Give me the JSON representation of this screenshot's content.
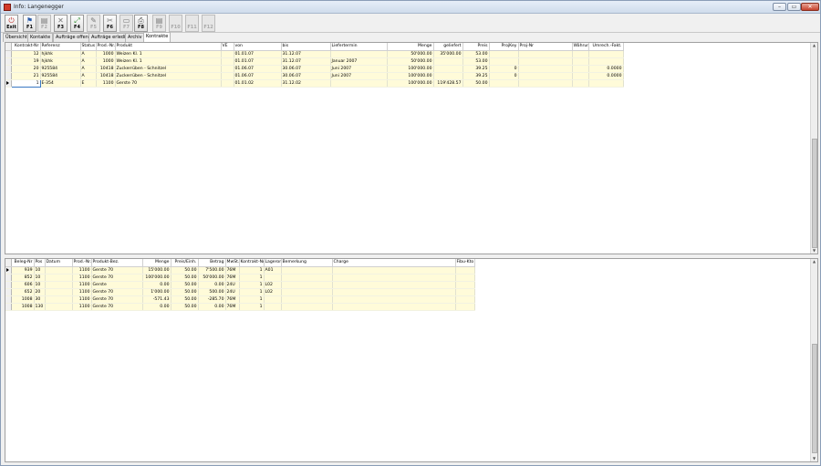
{
  "window": {
    "title": "Info: Langenegger",
    "controls": [
      "–",
      "▭",
      "✕"
    ]
  },
  "toolbar": [
    {
      "label": "Exit",
      "icon": "⏻",
      "color": "#c0302a",
      "enabled": true
    },
    {
      "label": "F1",
      "icon": "⚑",
      "color": "#2a5aa8",
      "enabled": true
    },
    {
      "label": "F2",
      "icon": "▤",
      "color": "#777",
      "enabled": false
    },
    {
      "label": "F3",
      "icon": "✕",
      "color": "#777",
      "enabled": true
    },
    {
      "label": "F4",
      "icon": "⤢",
      "color": "#2f8f2f",
      "enabled": true
    },
    {
      "label": "F5",
      "icon": "✎",
      "color": "#777",
      "enabled": false
    },
    {
      "label": "F6",
      "icon": "✂",
      "color": "#777",
      "enabled": true
    },
    {
      "label": "F7",
      "icon": "▭",
      "color": "#777",
      "enabled": false
    },
    {
      "label": "F8",
      "icon": "⎙",
      "color": "#555",
      "enabled": true
    },
    {
      "label": "F9",
      "icon": "▤",
      "color": "#777",
      "enabled": false
    },
    {
      "label": "F10",
      "icon": "",
      "color": "#777",
      "enabled": false
    },
    {
      "label": "F11",
      "icon": "",
      "color": "#777",
      "enabled": false
    },
    {
      "label": "F12",
      "icon": "",
      "color": "#777",
      "enabled": false
    }
  ],
  "tabs": [
    "Übersicht",
    "Kontakte",
    "Aufträge offen",
    "Aufträge erledigt",
    "Archiv",
    "Kontrakte"
  ],
  "active_tab": 5,
  "contracts": {
    "columns": [
      "Kontrakt-Nr",
      "Referenz",
      "Status",
      "Prod.-Nr.",
      "Produkt",
      "VE",
      "von",
      "bis",
      "Liefertermin",
      "Menge",
      "geliefert",
      "Preis",
      "ProjKey",
      "Proj-Nr",
      "Währung",
      "Umrech.-Fakt."
    ],
    "rows": [
      [
        "12",
        "hjkhk",
        "A",
        "1000",
        "Weizen Kl. 1",
        "",
        "01.01.07",
        "31.12.07",
        "",
        "50'000.00",
        "35'000.00",
        "53.00",
        "",
        "",
        "",
        ""
      ],
      [
        "19",
        "hjkhk",
        "A",
        "1000",
        "Weizen Kl. 1",
        "",
        "01.01.07",
        "31.12.07",
        "Januar 2007",
        "50'000.00",
        "",
        "53.00",
        "",
        "",
        "",
        ""
      ],
      [
        "20",
        "925584",
        "A",
        "10418",
        "Zuckerrüben - Schnitzel",
        "",
        "01.06.07",
        "30.06.07",
        "Juni 2007",
        "100'000.00",
        "",
        "39.25",
        "0",
        "",
        "",
        "0.0000"
      ],
      [
        "21",
        "925584",
        "A",
        "10418",
        "Zuckerrüben - Schnitzel",
        "",
        "01.06.07",
        "30.06.07",
        "Juni 2007",
        "100'000.00",
        "",
        "39.25",
        "0",
        "",
        "",
        "0.0000"
      ],
      [
        "1",
        "E-354",
        "E",
        "1100",
        "Gerste 70",
        "",
        "01.01.02",
        "31.12.02",
        "",
        "100'000.00",
        "119'428.57",
        "50.00",
        "",
        "",
        "",
        ""
      ]
    ],
    "selected_row": 4
  },
  "documents": {
    "columns": [
      "Beleg-Nr",
      "Pos",
      "Datum",
      "Prod.-Nr.",
      "Produkt-Bez.",
      "Menge",
      "Preis/Einh.",
      "Betrag",
      "MwSt.",
      "Kontrakt-Nr",
      "Lagerort",
      "Bemerkung",
      "Charge",
      "Fibu-Kto"
    ],
    "rows": [
      [
        "939",
        "10",
        "",
        "1100",
        "Gerste 70",
        "15'000.00",
        "50.00",
        "7'500.00",
        "76M",
        "1",
        "A01",
        "",
        "",
        ""
      ],
      [
        "852",
        "10",
        "",
        "1100",
        "Gerste 70",
        "100'000.00",
        "50.00",
        "50'000.00",
        "76M",
        "1",
        "",
        "",
        "",
        ""
      ],
      [
        "606",
        "10",
        "",
        "1100",
        "Gerste",
        "0.00",
        "50.00",
        "0.00",
        "24U",
        "1",
        "L02",
        "",
        "",
        ""
      ],
      [
        "652",
        "20",
        "",
        "1100",
        "Gerste 70",
        "1'000.00",
        "50.00",
        "500.00",
        "24U",
        "1",
        "L02",
        "",
        "",
        ""
      ],
      [
        "1008",
        "30",
        "",
        "1100",
        "Gerste 70",
        "-571.43",
        "50.00",
        "-285.70",
        "76M",
        "1",
        "",
        "",
        "",
        ""
      ],
      [
        "1008",
        "130",
        "",
        "1100",
        "Gerste 70",
        "0.00",
        "50.00",
        "0.00",
        "76M",
        "1",
        "",
        "",
        "",
        ""
      ]
    ],
    "selected_row": 0
  }
}
